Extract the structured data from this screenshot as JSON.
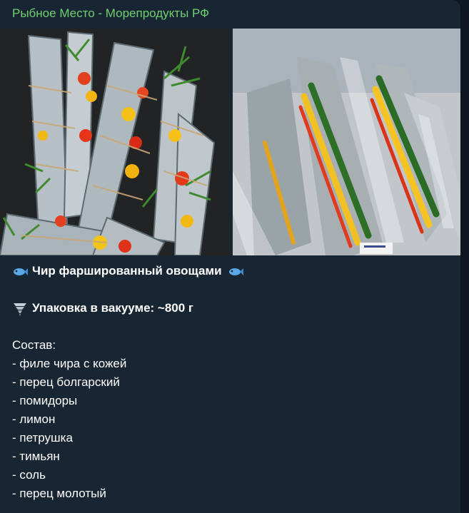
{
  "message": {
    "channel_name": "Рыбное Место - Морепродукты РФ",
    "title": "Чир фаршированный овощами",
    "title_icon": "fish-icon",
    "package_icon": "tornado-icon",
    "package_text": "Упаковка в вакууме: ~800 г",
    "composition_label": "Состав:",
    "ingredients": [
      "- филе чира с кожей",
      "- перец болгарский",
      "- помидоры",
      "- лимон",
      "- петрушка",
      "- тимьян",
      "- соль",
      "- перец молотый"
    ],
    "colors": {
      "bubble": "#182533",
      "background": "#0e1621",
      "channel_name": "#6fcf71",
      "text": "#ffffff"
    }
  }
}
